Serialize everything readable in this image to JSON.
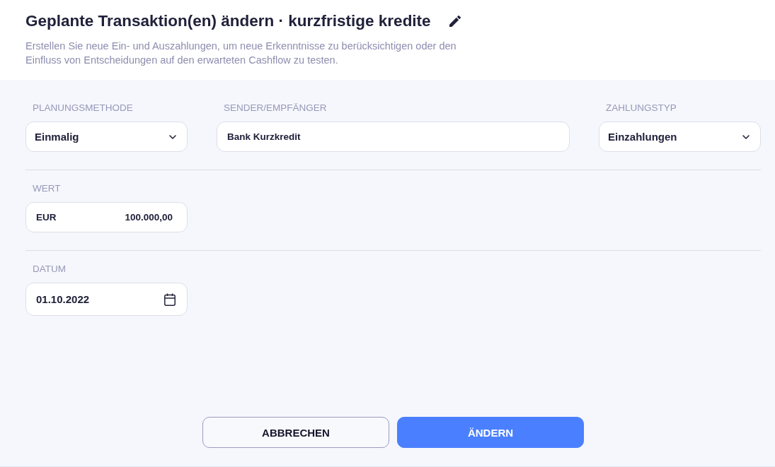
{
  "header": {
    "title": "Geplante Transaktion(en) ändern · kurzfristige kredite",
    "description": "Erstellen Sie neue Ein- und Auszahlungen, um neue Erkenntnisse zu berücksichtigen oder den Einfluss von Entscheidungen auf den erwarteten Cashflow zu testen."
  },
  "form": {
    "rows": [
      {
        "fields": [
          {
            "kind": "select",
            "label": "PLANUNGSMETHODE",
            "value": "Einmalig"
          },
          {
            "kind": "text",
            "label": "SENDER/EMPFÄNGER",
            "value": "Bank Kurzkredit"
          },
          {
            "kind": "select",
            "label": "ZAHLUNGSTYP",
            "value": "Einzahlungen"
          }
        ]
      },
      {
        "fields": [
          {
            "kind": "amount",
            "label": "WERT",
            "currency": "EUR",
            "value": "100.000,00"
          }
        ]
      },
      {
        "fields": [
          {
            "kind": "date",
            "label": "DATUM",
            "value": "01.10.2022"
          }
        ]
      }
    ]
  },
  "buttons": [
    {
      "kind": "secondary",
      "label": "ABBRECHEN"
    },
    {
      "kind": "primary",
      "label": "ÄNDERN"
    }
  ]
}
